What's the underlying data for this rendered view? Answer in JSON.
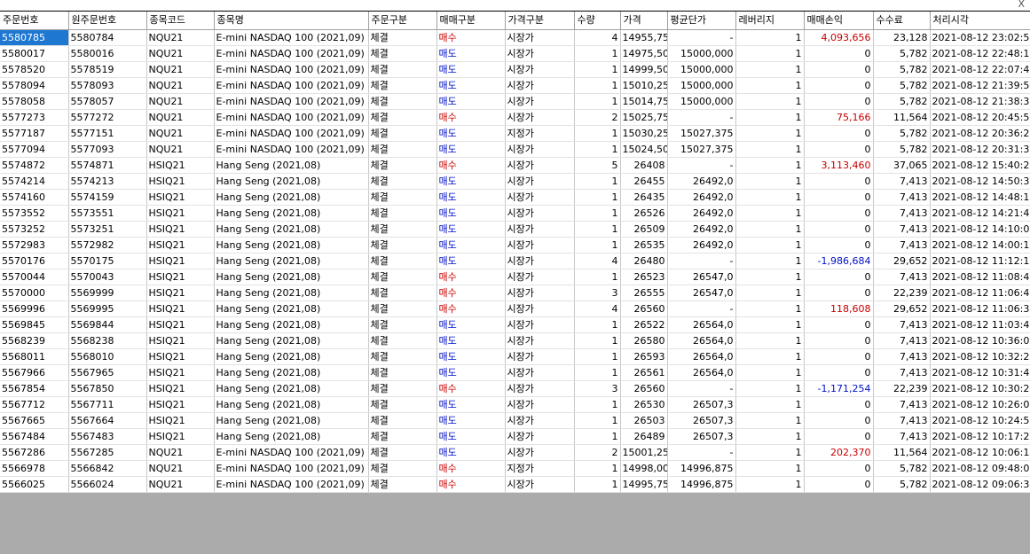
{
  "columns": [
    "주문번호",
    "원주문번호",
    "종목코드",
    "종목명",
    "주문구분",
    "매매구분",
    "가격구분",
    "수량",
    "가격",
    "평균단가",
    "레버리지",
    "매매손익",
    "수수료",
    "처리시각"
  ],
  "rows": [
    [
      "5580785",
      "5580784",
      "NQU21",
      "E-mini NASDAQ 100 (2021,09)",
      "체결",
      "매수",
      "시장가",
      "4",
      "14955,75",
      "-",
      "1",
      "4,093,656",
      "23,128",
      "2021-08-12 23:02:57"
    ],
    [
      "5580017",
      "5580016",
      "NQU21",
      "E-mini NASDAQ 100 (2021,09)",
      "체결",
      "매도",
      "시장가",
      "1",
      "14975,50",
      "15000,000",
      "1",
      "0",
      "5,782",
      "2021-08-12 22:48:13"
    ],
    [
      "5578520",
      "5578519",
      "NQU21",
      "E-mini NASDAQ 100 (2021,09)",
      "체결",
      "매도",
      "시장가",
      "1",
      "14999,50",
      "15000,000",
      "1",
      "0",
      "5,782",
      "2021-08-12 22:07:40"
    ],
    [
      "5578094",
      "5578093",
      "NQU21",
      "E-mini NASDAQ 100 (2021,09)",
      "체결",
      "매도",
      "시장가",
      "1",
      "15010,25",
      "15000,000",
      "1",
      "0",
      "5,782",
      "2021-08-12 21:39:50"
    ],
    [
      "5578058",
      "5578057",
      "NQU21",
      "E-mini NASDAQ 100 (2021,09)",
      "체결",
      "매도",
      "시장가",
      "1",
      "15014,75",
      "15000,000",
      "1",
      "0",
      "5,782",
      "2021-08-12 21:38:33"
    ],
    [
      "5577273",
      "5577272",
      "NQU21",
      "E-mini NASDAQ 100 (2021,09)",
      "체결",
      "매수",
      "시장가",
      "2",
      "15025,75",
      "-",
      "1",
      "75,166",
      "11,564",
      "2021-08-12 20:45:59"
    ],
    [
      "5577187",
      "5577151",
      "NQU21",
      "E-mini NASDAQ 100 (2021,09)",
      "체결",
      "매도",
      "지정가",
      "1",
      "15030,25",
      "15027,375",
      "1",
      "0",
      "5,782",
      "2021-08-12 20:36:25"
    ],
    [
      "5577094",
      "5577093",
      "NQU21",
      "E-mini NASDAQ 100 (2021,09)",
      "체결",
      "매도",
      "시장가",
      "1",
      "15024,50",
      "15027,375",
      "1",
      "0",
      "5,782",
      "2021-08-12 20:31:38"
    ],
    [
      "5574872",
      "5574871",
      "HSIQ21",
      "Hang Seng (2021,08)",
      "체결",
      "매수",
      "시장가",
      "5",
      "26408",
      "-",
      "1",
      "3,113,460",
      "37,065",
      "2021-08-12 15:40:23"
    ],
    [
      "5574214",
      "5574213",
      "HSIQ21",
      "Hang Seng (2021,08)",
      "체결",
      "매도",
      "시장가",
      "1",
      "26455",
      "26492,0",
      "1",
      "0",
      "7,413",
      "2021-08-12 14:50:39"
    ],
    [
      "5574160",
      "5574159",
      "HSIQ21",
      "Hang Seng (2021,08)",
      "체결",
      "매도",
      "시장가",
      "1",
      "26435",
      "26492,0",
      "1",
      "0",
      "7,413",
      "2021-08-12 14:48:17"
    ],
    [
      "5573552",
      "5573551",
      "HSIQ21",
      "Hang Seng (2021,08)",
      "체결",
      "매도",
      "시장가",
      "1",
      "26526",
      "26492,0",
      "1",
      "0",
      "7,413",
      "2021-08-12 14:21:43"
    ],
    [
      "5573252",
      "5573251",
      "HSIQ21",
      "Hang Seng (2021,08)",
      "체결",
      "매도",
      "시장가",
      "1",
      "26509",
      "26492,0",
      "1",
      "0",
      "7,413",
      "2021-08-12 14:10:00"
    ],
    [
      "5572983",
      "5572982",
      "HSIQ21",
      "Hang Seng (2021,08)",
      "체결",
      "매도",
      "시장가",
      "1",
      "26535",
      "26492,0",
      "1",
      "0",
      "7,413",
      "2021-08-12 14:00:17"
    ],
    [
      "5570176",
      "5570175",
      "HSIQ21",
      "Hang Seng (2021,08)",
      "체결",
      "매도",
      "시장가",
      "4",
      "26480",
      "-",
      "1",
      "-1,986,684",
      "29,652",
      "2021-08-12 11:12:12"
    ],
    [
      "5570044",
      "5570043",
      "HSIQ21",
      "Hang Seng (2021,08)",
      "체결",
      "매수",
      "시장가",
      "1",
      "26523",
      "26547,0",
      "1",
      "0",
      "7,413",
      "2021-08-12 11:08:42"
    ],
    [
      "5570000",
      "5569999",
      "HSIQ21",
      "Hang Seng (2021,08)",
      "체결",
      "매수",
      "시장가",
      "3",
      "26555",
      "26547,0",
      "1",
      "0",
      "22,239",
      "2021-08-12 11:06:40"
    ],
    [
      "5569996",
      "5569995",
      "HSIQ21",
      "Hang Seng (2021,08)",
      "체결",
      "매수",
      "시장가",
      "4",
      "26560",
      "-",
      "1",
      "118,608",
      "29,652",
      "2021-08-12 11:06:34"
    ],
    [
      "5569845",
      "5569844",
      "HSIQ21",
      "Hang Seng (2021,08)",
      "체결",
      "매도",
      "시장가",
      "1",
      "26522",
      "26564,0",
      "1",
      "0",
      "7,413",
      "2021-08-12 11:03:45"
    ],
    [
      "5568239",
      "5568238",
      "HSIQ21",
      "Hang Seng (2021,08)",
      "체결",
      "매도",
      "시장가",
      "1",
      "26580",
      "26564,0",
      "1",
      "0",
      "7,413",
      "2021-08-12 10:36:05"
    ],
    [
      "5568011",
      "5568010",
      "HSIQ21",
      "Hang Seng (2021,08)",
      "체결",
      "매도",
      "시장가",
      "1",
      "26593",
      "26564,0",
      "1",
      "0",
      "7,413",
      "2021-08-12 10:32:23"
    ],
    [
      "5567966",
      "5567965",
      "HSIQ21",
      "Hang Seng (2021,08)",
      "체결",
      "매도",
      "시장가",
      "1",
      "26561",
      "26564,0",
      "1",
      "0",
      "7,413",
      "2021-08-12 10:31:49"
    ],
    [
      "5567854",
      "5567850",
      "HSIQ21",
      "Hang Seng (2021,08)",
      "체결",
      "매수",
      "시장가",
      "3",
      "26560",
      "-",
      "1",
      "-1,171,254",
      "22,239",
      "2021-08-12 10:30:26"
    ],
    [
      "5567712",
      "5567711",
      "HSIQ21",
      "Hang Seng (2021,08)",
      "체결",
      "매도",
      "시장가",
      "1",
      "26530",
      "26507,3",
      "1",
      "0",
      "7,413",
      "2021-08-12 10:26:03"
    ],
    [
      "5567665",
      "5567664",
      "HSIQ21",
      "Hang Seng (2021,08)",
      "체결",
      "매도",
      "시장가",
      "1",
      "26503",
      "26507,3",
      "1",
      "0",
      "7,413",
      "2021-08-12 10:24:52"
    ],
    [
      "5567484",
      "5567483",
      "HSIQ21",
      "Hang Seng (2021,08)",
      "체결",
      "매도",
      "시장가",
      "1",
      "26489",
      "26507,3",
      "1",
      "0",
      "7,413",
      "2021-08-12 10:17:27"
    ],
    [
      "5567286",
      "5567285",
      "NQU21",
      "E-mini NASDAQ 100 (2021,09)",
      "체결",
      "매도",
      "시장가",
      "2",
      "15001,25",
      "-",
      "1",
      "202,370",
      "11,564",
      "2021-08-12 10:06:14"
    ],
    [
      "5566978",
      "5566842",
      "NQU21",
      "E-mini NASDAQ 100 (2021,09)",
      "체결",
      "매수",
      "지정가",
      "1",
      "14998,00",
      "14996,875",
      "1",
      "0",
      "5,782",
      "2021-08-12 09:48:09"
    ],
    [
      "5566025",
      "5566024",
      "NQU21",
      "E-mini NASDAQ 100 (2021,09)",
      "체결",
      "매수",
      "시장가",
      "1",
      "14995,75",
      "14996,875",
      "1",
      "0",
      "5,782",
      "2021-08-12 09:06:30"
    ]
  ],
  "close_glyph": "X",
  "colors": {
    "buy": "#c80000",
    "sell": "#0010c8",
    "selection": "#1e78d2",
    "empty_area": "#ababab"
  }
}
